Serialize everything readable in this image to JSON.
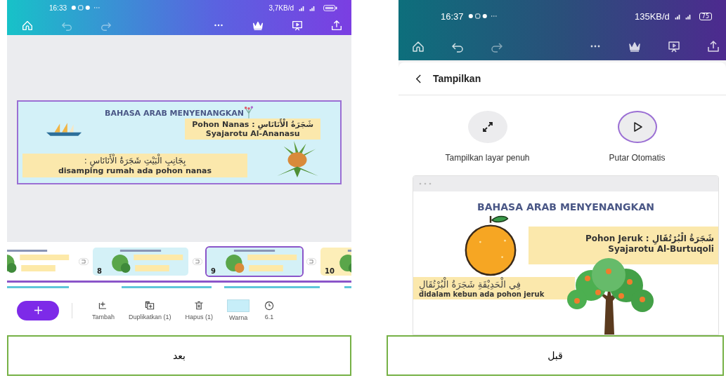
{
  "after_panel": {
    "status_bar": {
      "time": "16:33",
      "network_speed": "3,7KB/d"
    },
    "slide": {
      "title": "BAHASA ARAB MENYENANGKAN",
      "label_line": "Pohon Nanas : شَجَرَةُ الْأَنَانَاسِ",
      "transliteration": "Syajarotu Al-Ananasu",
      "sentence_arabic": "بِجَانِبِ الْبَيْتِ شَجَرَةُ الْأَنَانَاسِ :",
      "sentence": "disamping rumah ada pohon nanas"
    },
    "thumbnails": [
      {
        "selected": false
      },
      {
        "number": "8",
        "selected": false
      },
      {
        "number": "9",
        "selected": true
      },
      {
        "number": "10",
        "selected": false
      }
    ],
    "toolbar": [
      {
        "kind": "add",
        "label": "Tambah"
      },
      {
        "kind": "duplicate",
        "label": "Duplikatkan (1)"
      },
      {
        "kind": "delete",
        "label": "Hapus (1)"
      },
      {
        "kind": "color",
        "label": "Warna"
      },
      {
        "kind": "timer",
        "label": "6.1"
      }
    ],
    "caption": "بعد"
  },
  "before_panel": {
    "status_bar": {
      "time": "16:37",
      "network_speed": "135KB/d",
      "battery": "75"
    },
    "header": {
      "title": "Tampilkan"
    },
    "options": [
      {
        "kind": "fullscreen",
        "label": "Tampilkan layar penuh",
        "selected": false
      },
      {
        "kind": "autoplay",
        "label": "Putar Otomatis",
        "selected": true
      }
    ],
    "slide": {
      "title": "BAHASA ARAB MENYENANGKAN",
      "label_line": "Pohon Jeruk : شَجَرَةُ الْبُرْتُقَالِ",
      "transliteration": "Syajarotu Al-Burtuqoli",
      "sentence_arabic": "فِي الْحَدِيْقَةِ شَجَرَةُ الْبُرْتُقَالِ",
      "sentence": "didalam kebun ada pohon jeruk"
    },
    "caption": "قبل"
  }
}
